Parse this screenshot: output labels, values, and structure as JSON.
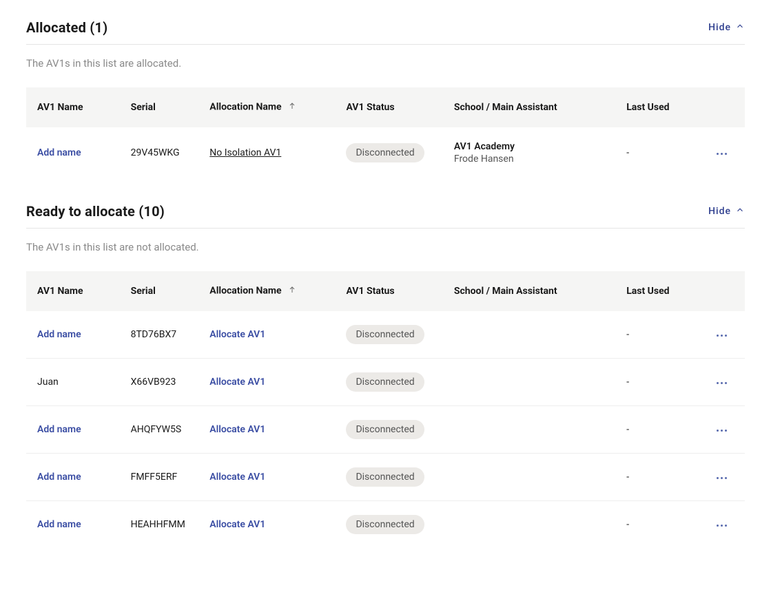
{
  "ui": {
    "hide_label": "Hide"
  },
  "columns": {
    "name": "AV1 Name",
    "serial": "Serial",
    "allocation": "Allocation Name",
    "status": "AV1 Status",
    "school": "School / Main Assistant",
    "last": "Last Used"
  },
  "links": {
    "add_name": "Add name",
    "allocate": "Allocate AV1"
  },
  "allocated": {
    "title": "Allocated (1)",
    "description": "The AV1s in this list are allocated.",
    "rows": [
      {
        "name": null,
        "serial": "29V45WKG",
        "allocation_name": "No Isolation AV1",
        "status": "Disconnected",
        "school": "AV1 Academy",
        "assistant": "Frode Hansen",
        "last_used": "-"
      }
    ]
  },
  "ready": {
    "title": "Ready to allocate (10)",
    "description": "The AV1s in this list are not allocated.",
    "rows": [
      {
        "name": null,
        "serial": "8TD76BX7",
        "status": "Disconnected",
        "last_used": "-"
      },
      {
        "name": "Juan",
        "serial": "X66VB923",
        "status": "Disconnected",
        "last_used": "-"
      },
      {
        "name": null,
        "serial": "AHQFYW5S",
        "status": "Disconnected",
        "last_used": "-"
      },
      {
        "name": null,
        "serial": "FMFF5ERF",
        "status": "Disconnected",
        "last_used": "-"
      },
      {
        "name": null,
        "serial": "HEAHHFMM",
        "status": "Disconnected",
        "last_used": "-"
      }
    ]
  }
}
